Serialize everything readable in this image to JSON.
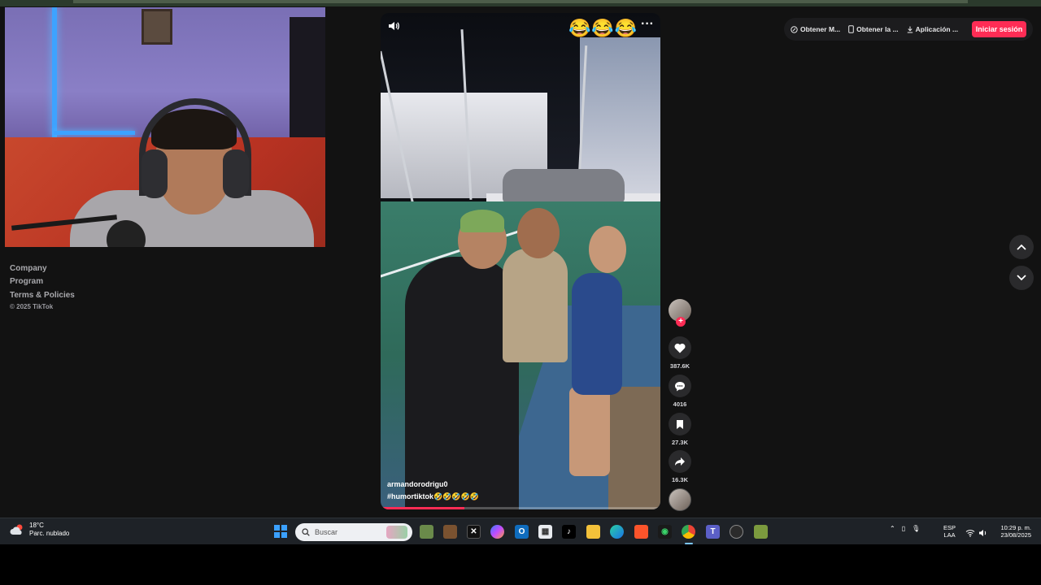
{
  "footer": {
    "links": [
      "Company",
      "Program",
      "Terms & Policies"
    ],
    "copyright": "© 2025 TikTok"
  },
  "header": {
    "buttons": [
      {
        "label": "Obtener M...",
        "icon": "coin-icon"
      },
      {
        "label": "Obtener la ...",
        "icon": "phone-icon"
      },
      {
        "label": "Aplicación ...",
        "icon": "download-icon"
      }
    ],
    "login_label": "Iniciar sesión",
    "accent_color": "#fe2c55"
  },
  "video": {
    "top_emojis": "😂😂😂",
    "more_label": "···",
    "author": "armandorodrigu0",
    "caption": "#humortiktok🤣🤣🤣🤣🤣",
    "progress": 0.3
  },
  "actions": {
    "follow_plus": "+",
    "likes": "387.6K",
    "comments": "4016",
    "saves": "27.3K",
    "shares": "16.3K"
  },
  "taskbar": {
    "weather_temp": "18°C",
    "weather_desc": "Parc. nublado",
    "weather_badge": "1",
    "search_placeholder": "Buscar",
    "lang_top": "ESP",
    "lang_bottom": "LAA",
    "time": "10:29 p. m.",
    "date": "23/08/2025"
  }
}
